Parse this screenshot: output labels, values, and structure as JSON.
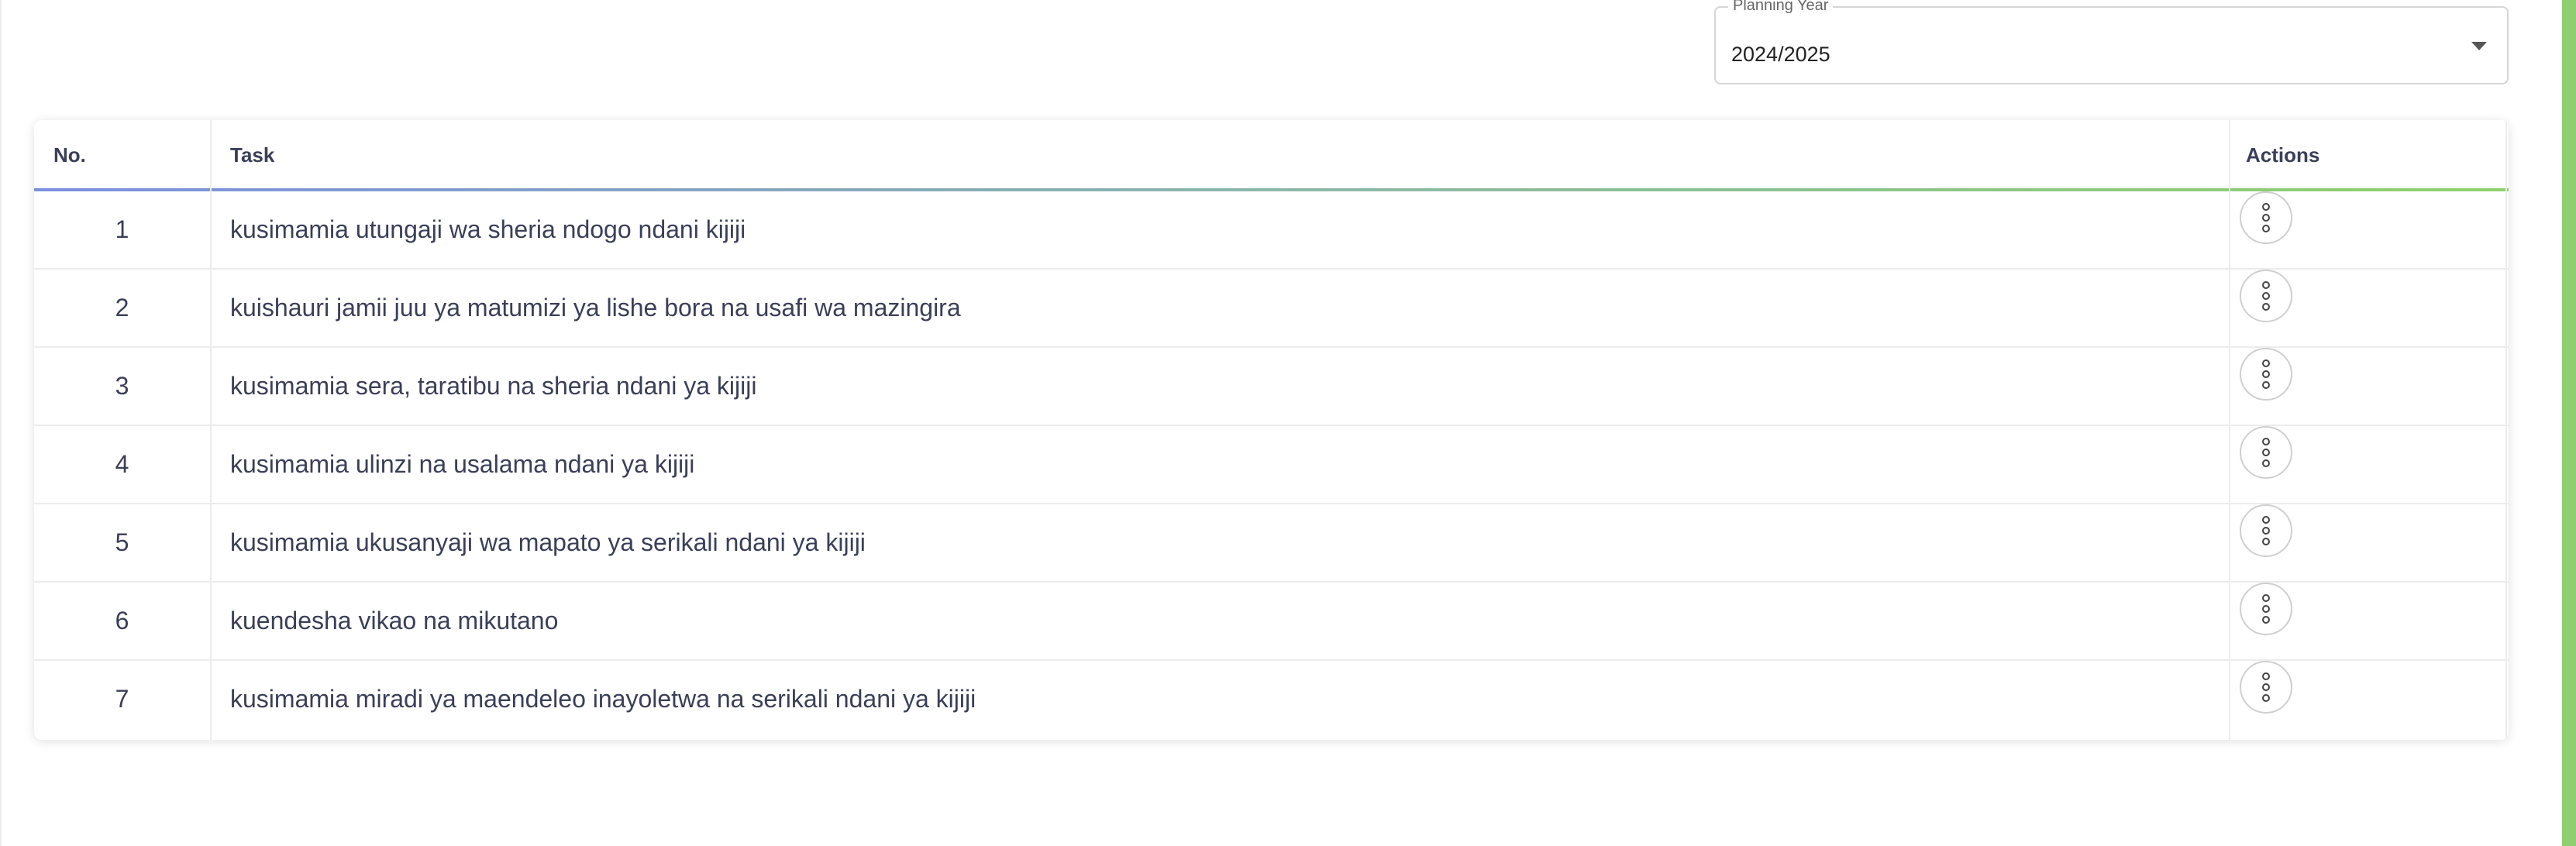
{
  "filters": {
    "planning_year_label": "Planning Year",
    "planning_year_value": "2024/2025"
  },
  "table": {
    "headers": {
      "no": "No.",
      "task": "Task",
      "actions": "Actions"
    },
    "rows": [
      {
        "no": "1",
        "task": "kusimamia utungaji wa sheria ndogo ndani kijiji"
      },
      {
        "no": "2",
        "task": "kuishauri jamii juu ya matumizi ya lishe bora na usafi wa mazingira"
      },
      {
        "no": "3",
        "task": "kusimamia sera, taratibu na sheria ndani ya kijiji"
      },
      {
        "no": "4",
        "task": "kusimamia ulinzi na usalama ndani ya kijiji"
      },
      {
        "no": "5",
        "task": "kusimamia ukusanyaji wa mapato ya serikali ndani ya kijiji"
      },
      {
        "no": "6",
        "task": "kuendesha vikao na mikutano"
      },
      {
        "no": "7",
        "task": "kusimamia miradi ya maendeleo inayoletwa na serikali ndani ya kijiji"
      }
    ]
  },
  "icons": {
    "row_action": "more-vertical-icon",
    "select_caret": "caret-down-icon"
  },
  "colors": {
    "accent_green": "#8fcf72",
    "header_gradient_start": "#7a8fe0",
    "header_gradient_end": "#8fd16a"
  }
}
